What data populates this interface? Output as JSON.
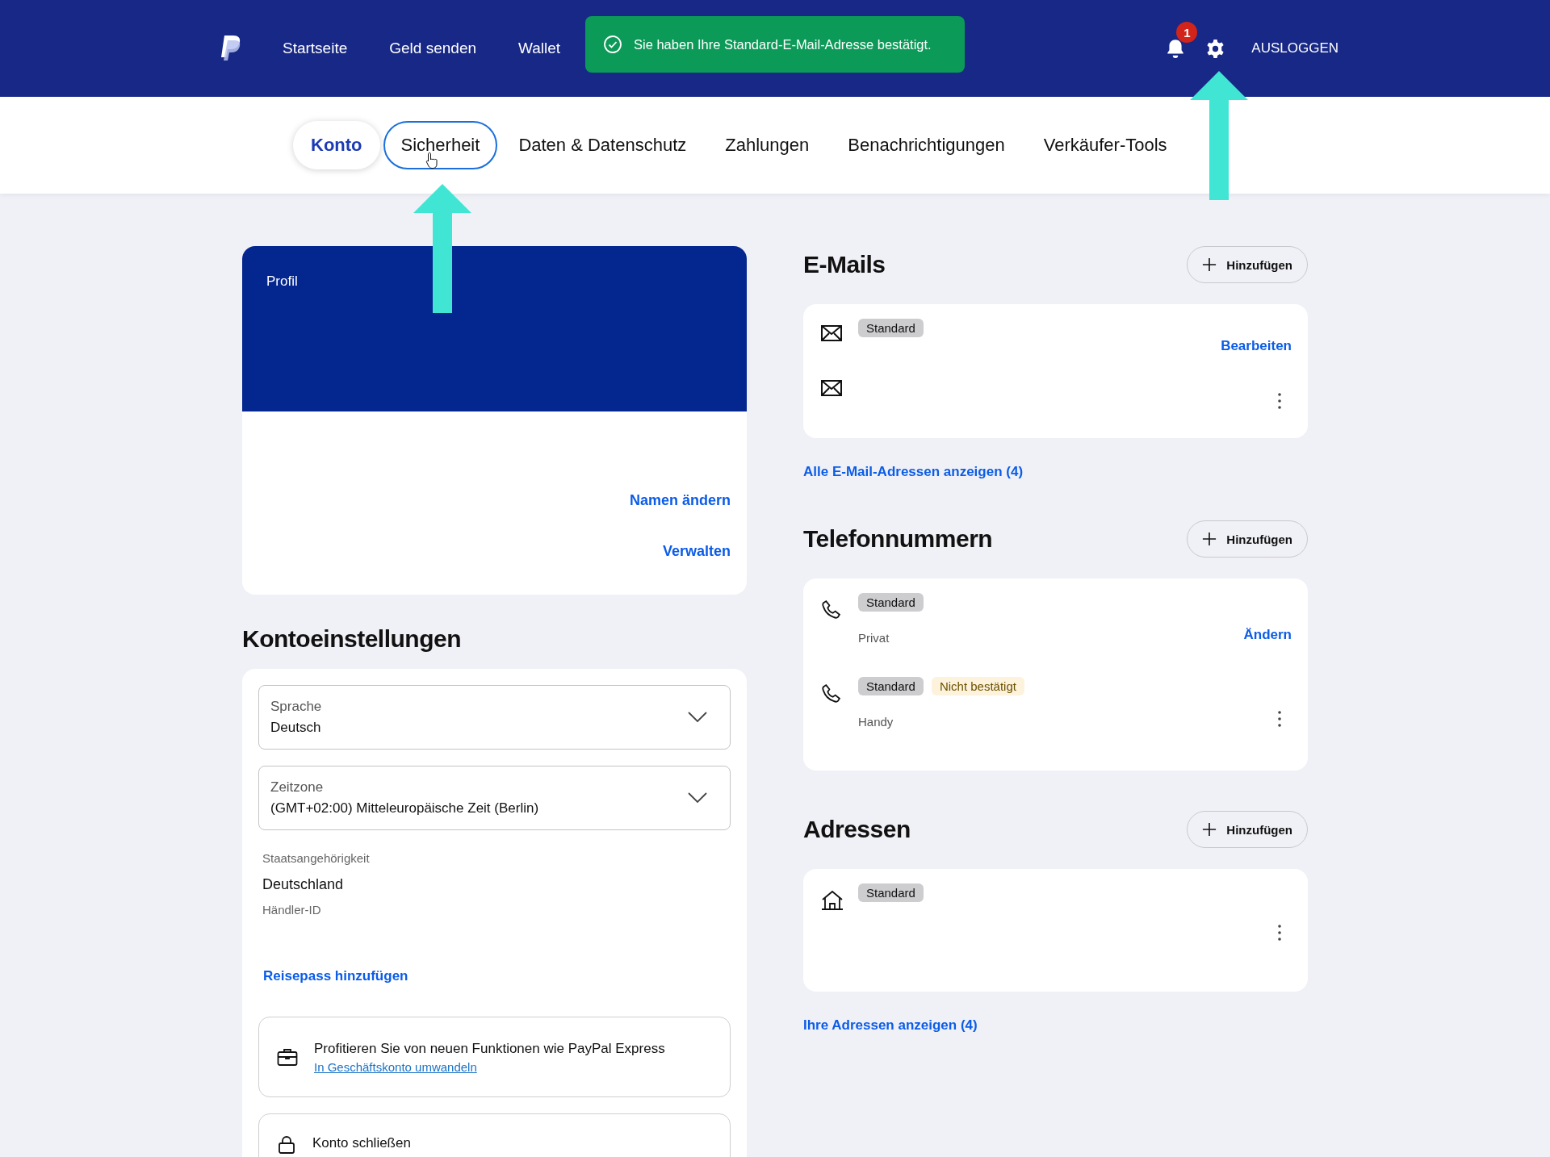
{
  "header": {
    "nav": [
      {
        "label": "Startseite"
      },
      {
        "label": "Geld senden"
      },
      {
        "label": "Wallet"
      }
    ],
    "toast": {
      "message": "Sie haben Ihre Standard-E-Mail-Adresse bestätigt."
    },
    "notifications": {
      "count": "1"
    },
    "logout": "AUSLOGGEN"
  },
  "tabs": [
    {
      "label": "Konto",
      "selected": true,
      "focused": false
    },
    {
      "label": "Sicherheit",
      "selected": false,
      "focused": true
    },
    {
      "label": "Daten & Datenschutz",
      "selected": false,
      "focused": false
    },
    {
      "label": "Zahlungen",
      "selected": false,
      "focused": false
    },
    {
      "label": "Benachrichtigungen",
      "selected": false,
      "focused": false
    },
    {
      "label": "Verkäufer-Tools",
      "selected": false,
      "focused": false
    }
  ],
  "profile": {
    "title": "Profil",
    "links": [
      "Namen ändern",
      "Verwalten"
    ]
  },
  "account_settings": {
    "title": "Kontoeinstellungen",
    "selects": [
      {
        "label": "Sprache",
        "value": "Deutsch"
      },
      {
        "label": "Zeitzone",
        "value": "(GMT+02:00) Mitteleuropäische Zeit (Berlin)"
      }
    ],
    "fields": [
      {
        "label": "Staatsangehörigkeit",
        "value": "Deutschland"
      },
      {
        "label": "Händler-ID"
      }
    ],
    "passport_link": "Reisepass hinzufügen",
    "promo": {
      "text": "Profitieren Sie von neuen Funktionen wie PayPal Express",
      "link": "In Geschäftskonto umwandeln"
    },
    "close_account": {
      "text": "Konto schließen"
    }
  },
  "sections": [
    {
      "kind": "email",
      "title": "E-Mails",
      "add": "Hinzufügen",
      "items": [
        {
          "badges": [
            {
              "text": "Standard",
              "kind": "standard"
            }
          ],
          "action": "Bearbeiten",
          "menu": false
        },
        {
          "menu": true
        }
      ],
      "link": "Alle E-Mail-Adressen anzeigen (4)"
    },
    {
      "kind": "phone",
      "title": "Telefonnummern",
      "add": "Hinzufügen",
      "items": [
        {
          "badges": [
            {
              "text": "Standard",
              "kind": "standard"
            }
          ],
          "type_label": "Privat",
          "action": "Ändern",
          "menu": false
        },
        {
          "badges": [
            {
              "text": "Standard",
              "kind": "standard"
            },
            {
              "text": "Nicht bestätigt",
              "kind": "warning"
            }
          ],
          "type_label": "Handy",
          "menu": true
        }
      ]
    },
    {
      "kind": "address",
      "title": "Adressen",
      "add": "Hinzufügen",
      "items": [
        {
          "badges": [
            {
              "text": "Standard",
              "kind": "standard"
            }
          ],
          "menu": true
        }
      ],
      "link": "Ihre Adressen anzeigen (4)"
    }
  ]
}
